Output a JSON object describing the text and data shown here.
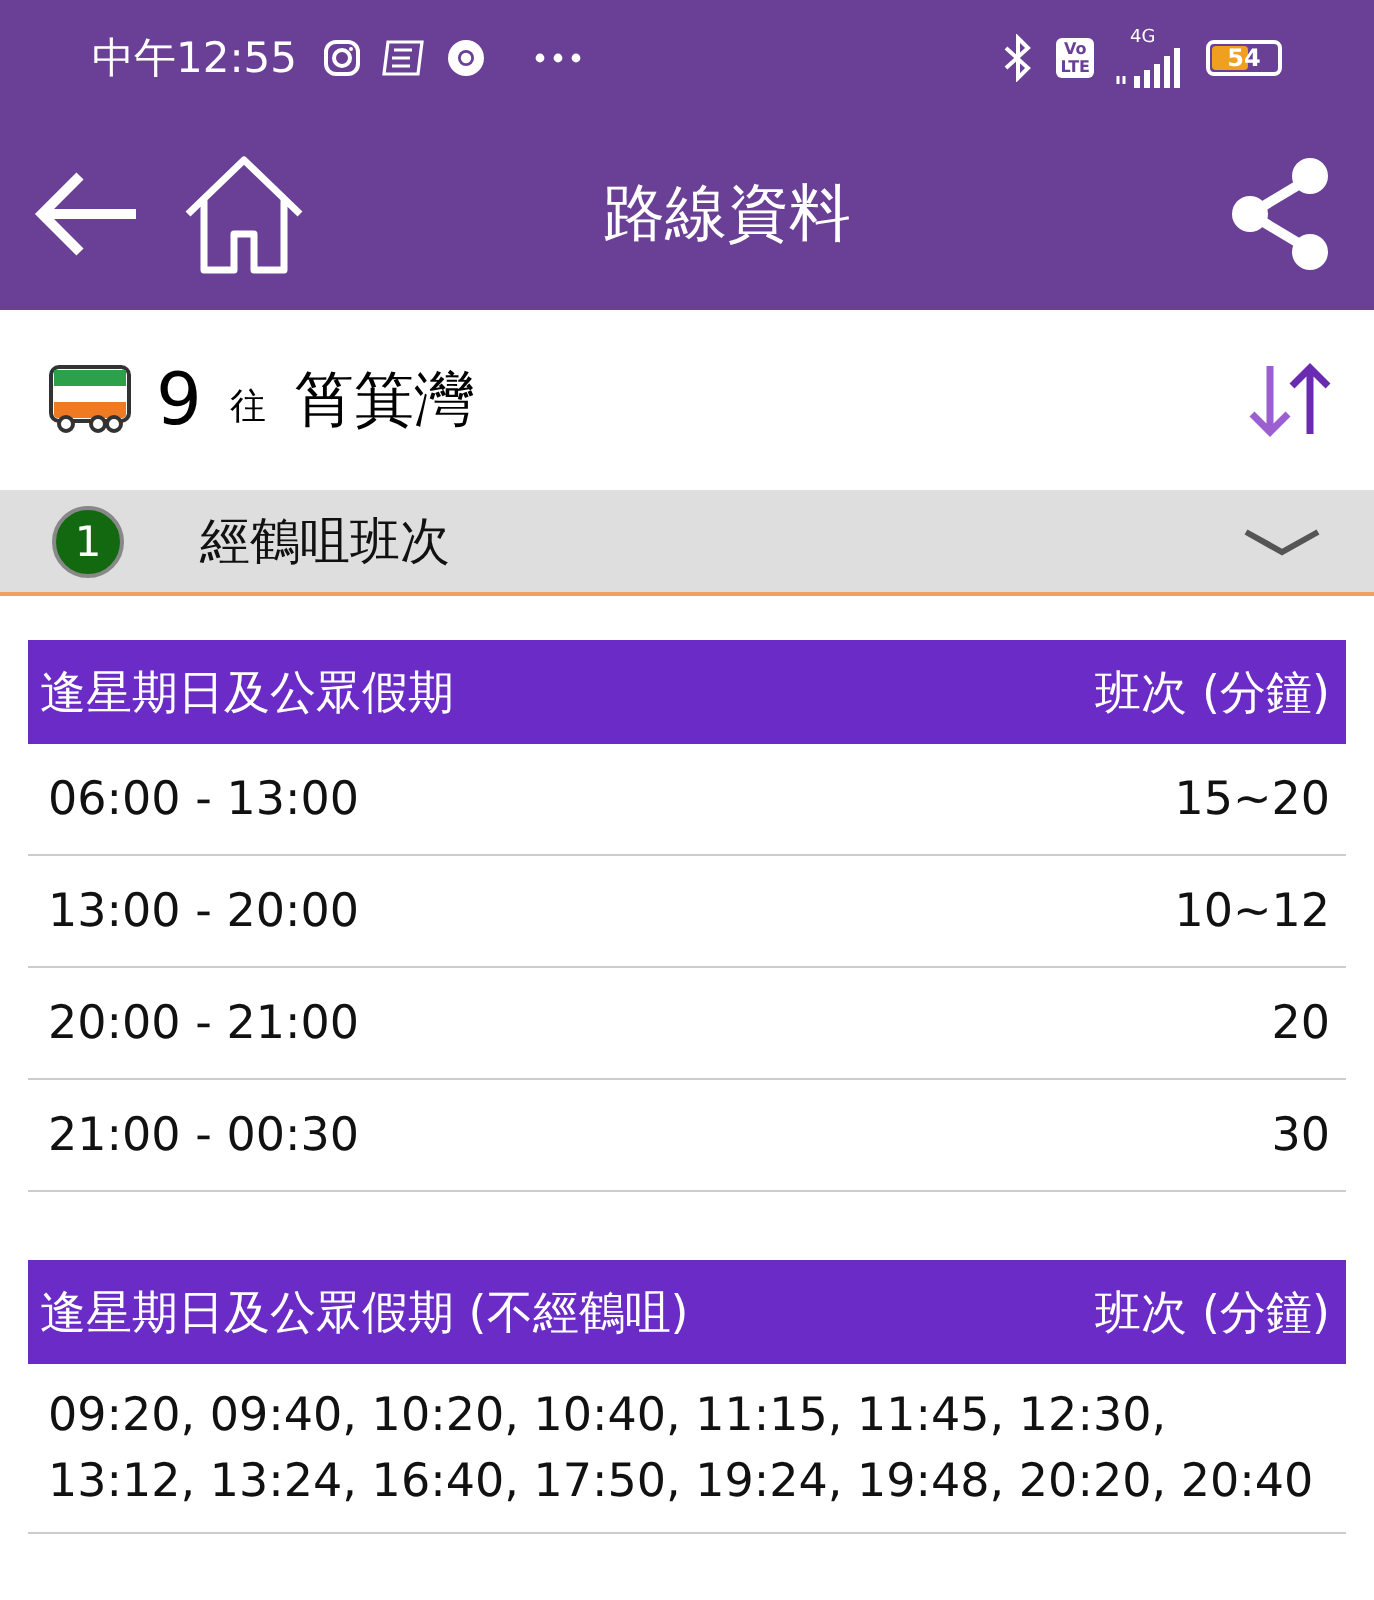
{
  "status_bar": {
    "time": "中午12:55",
    "volte": [
      "Vo",
      "LTE"
    ],
    "network": "4G",
    "battery": "54"
  },
  "app_bar": {
    "title": "路線資料"
  },
  "route": {
    "number": "9",
    "direction_label": "往",
    "destination": "筲箕灣"
  },
  "section": {
    "index": "1",
    "title": "經鶴咀班次",
    "expanded": false
  },
  "tables": [
    {
      "columns": [
        "逢星期日及公眾假期",
        "班次 (分鐘)"
      ],
      "kind": "rows",
      "rows": [
        [
          "06:00 - 13:00",
          "15~20"
        ],
        [
          "13:00 - 20:00",
          "10~12"
        ],
        [
          "20:00 - 21:00",
          "20"
        ],
        [
          "21:00 - 00:30",
          "30"
        ]
      ]
    },
    {
      "columns": [
        "逢星期日及公眾假期 (不經鶴咀)",
        "班次 (分鐘)"
      ],
      "kind": "text",
      "text": "09:20, 09:40, 10:20, 10:40, 11:15, 11:45, 12:30, 13:12, 13:24, 16:40, 17:50, 19:24, 19:48, 20:20, 20:40"
    }
  ]
}
